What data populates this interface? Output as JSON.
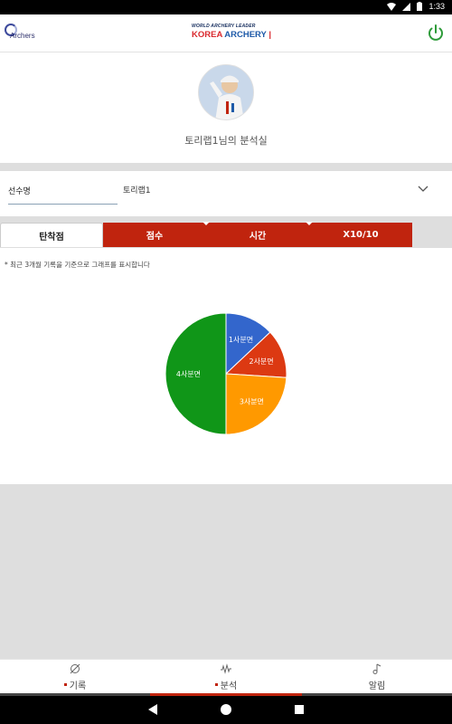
{
  "status_bar": {
    "time": "1:33",
    "icons": [
      "wifi-icon",
      "signal-icon",
      "battery-icon"
    ]
  },
  "header": {
    "left_logo": "Archers",
    "center_logo_top": "WORLD ARCHERY LEADER",
    "center_logo_main_red": "KOREA",
    "center_logo_main_blue": "ARCHERY",
    "power_icon": "power-icon"
  },
  "profile": {
    "title": "토리랩1님의 분석실"
  },
  "selector": {
    "label": "선수명",
    "value": "토리랩1"
  },
  "tabs": [
    {
      "label": "탄착점",
      "active": true
    },
    {
      "label": "점수",
      "active": false
    },
    {
      "label": "시간",
      "active": false
    },
    {
      "label": "X10/10",
      "active": false
    }
  ],
  "note": "* 최근 3개월 기록을 기준으로 그래프를 표시합니다",
  "chart_data": {
    "type": "pie",
    "title": "",
    "slices": [
      {
        "label": "1사분면",
        "value": 13,
        "color": "#3366cc"
      },
      {
        "label": "2사분면",
        "value": 13,
        "color": "#dc3912"
      },
      {
        "label": "3사분면",
        "value": 24,
        "color": "#ff9900"
      },
      {
        "label": "4사분면",
        "value": 50,
        "color": "#109618"
      }
    ]
  },
  "bottom_nav": {
    "items": [
      {
        "label": "기록",
        "icon": "bow-icon",
        "dot": true
      },
      {
        "label": "분석",
        "icon": "waveform-icon",
        "dot": true,
        "active": true
      },
      {
        "label": "알림",
        "icon": "music-note-icon",
        "dot": false
      }
    ]
  },
  "colors": {
    "accent_red": "#c0240e",
    "brand_blue": "#3d4a9c"
  }
}
